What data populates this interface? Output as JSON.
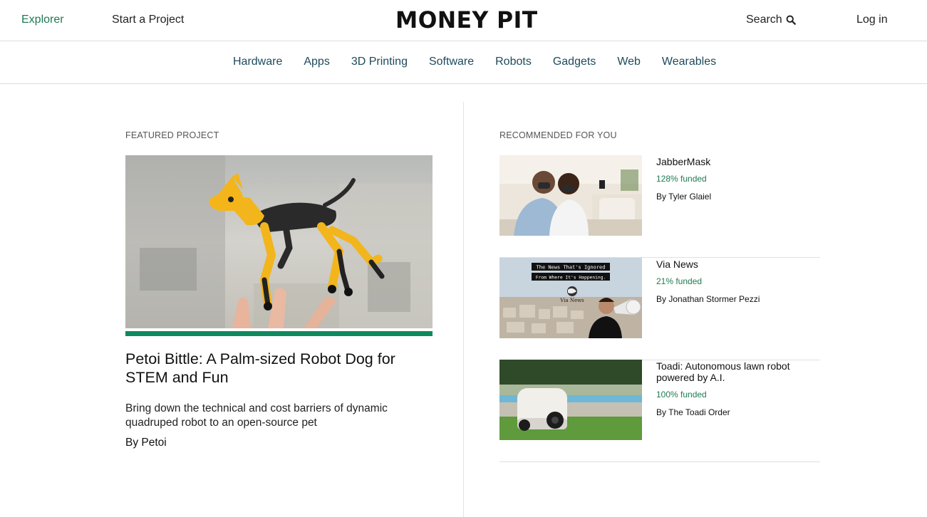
{
  "header": {
    "explorer_label": "Explorer",
    "start_label": "Start a Project",
    "logo_text": "MONEY PIT",
    "search_label": "Search",
    "login_label": "Log in"
  },
  "categories": [
    "Hardware",
    "Apps",
    "3D Printing",
    "Software",
    "Robots",
    "Gadgets",
    "Web",
    "Wearables"
  ],
  "featured": {
    "section_label": "FEATURED PROJECT",
    "title": "Petoi Bittle: A Palm-sized Robot Dog for STEM and Fun",
    "description": "Bring down the technical and cost barriers of dynamic quadruped robot to an open-source pet",
    "author": "By Petoi",
    "progress": 1.0,
    "accent_color": "#0f8a5f"
  },
  "recommended": {
    "section_label": "RECOMMENDED FOR YOU",
    "items": [
      {
        "title": "JabberMask",
        "funded": "128% funded",
        "by": "By Tyler Glaiel"
      },
      {
        "title": "Via News",
        "funded": "21% funded",
        "by": "By Jonathan Stormer Pezzi",
        "image_text": {
          "line1": "The News That's Ignored",
          "line2": "From Where It's Happening.",
          "logo": "Via News"
        }
      },
      {
        "title": "Toadi: Autonomous lawn robot powered by A.I.",
        "funded": "100% funded",
        "by": "By The Toadi Order"
      }
    ]
  },
  "colors": {
    "brand_green": "#1f7a52",
    "nav_text": "#1e4a5c"
  }
}
